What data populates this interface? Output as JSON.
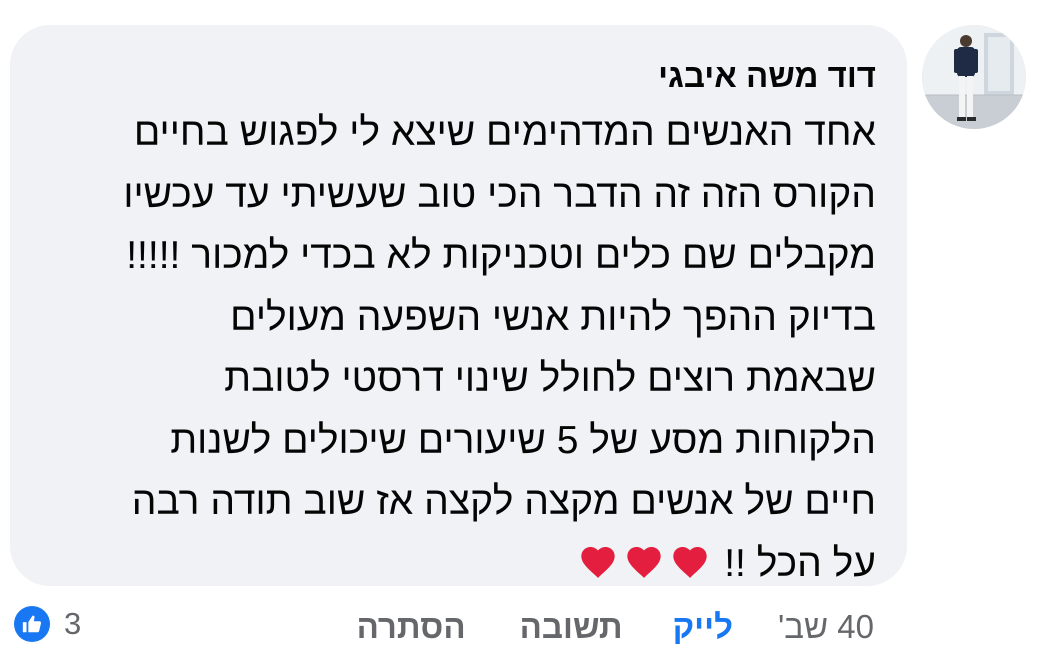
{
  "comment": {
    "author": "דוד משה איבגי",
    "lines": [
      "אחד האנשים המדהימים שיצא לי לפגוש בחיים",
      "הקורס  הזה זה הדבר הכי טוב שעשיתי עד עכשיו",
      "מקבלים שם כלים וטכניקות לא בכדי למכור !!!!!",
      "בדיוק ההפך להיות אנשי השפעה מעולים",
      "שבאמת רוצים לחולל שינוי דרסטי לטובת",
      "הלקוחות מסע של 5 שיעורים שיכולים לשנות",
      "חיים של אנשים מקצה לקצה אז שוב תודה רבה"
    ],
    "last_line_text": "על הכל !!",
    "emoji": [
      "red-heart",
      "red-heart",
      "red-heart"
    ]
  },
  "actions": {
    "time": "40 שב'",
    "like": "לייק",
    "reply": "תשובה",
    "hide": "הסתרה"
  },
  "reactions": {
    "type": "like",
    "count": "3"
  },
  "colors": {
    "bubble": "#f0f2f5",
    "text": "#050505",
    "secondary": "#65676b",
    "accent": "#1877f2",
    "heart": "#e41e3f"
  }
}
